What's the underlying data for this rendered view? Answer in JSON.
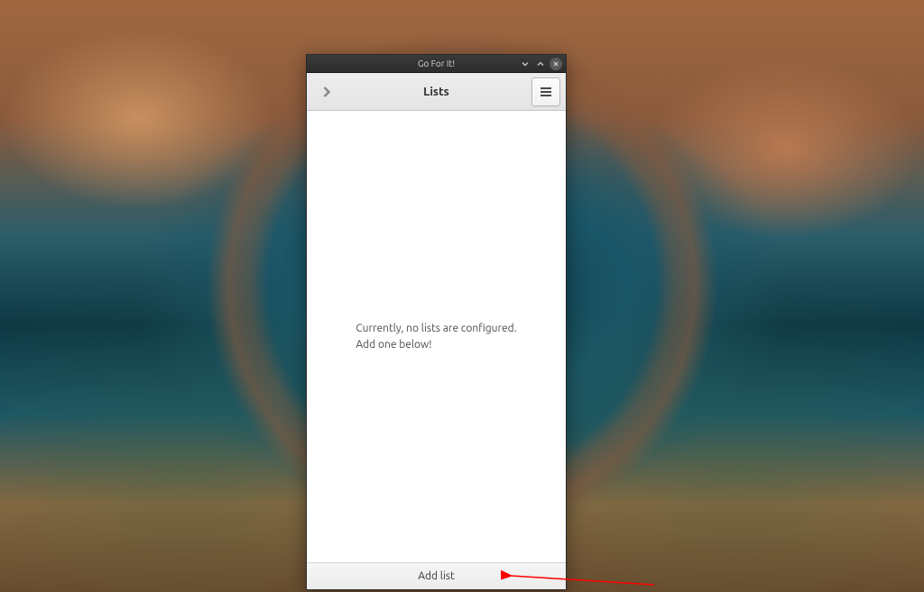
{
  "titlebar": {
    "title": "Go For It!"
  },
  "header": {
    "title": "Lists"
  },
  "content": {
    "empty_line1": "Currently, no lists are configured.",
    "empty_line2": "Add one below!"
  },
  "footer": {
    "add_list_label": "Add list"
  }
}
